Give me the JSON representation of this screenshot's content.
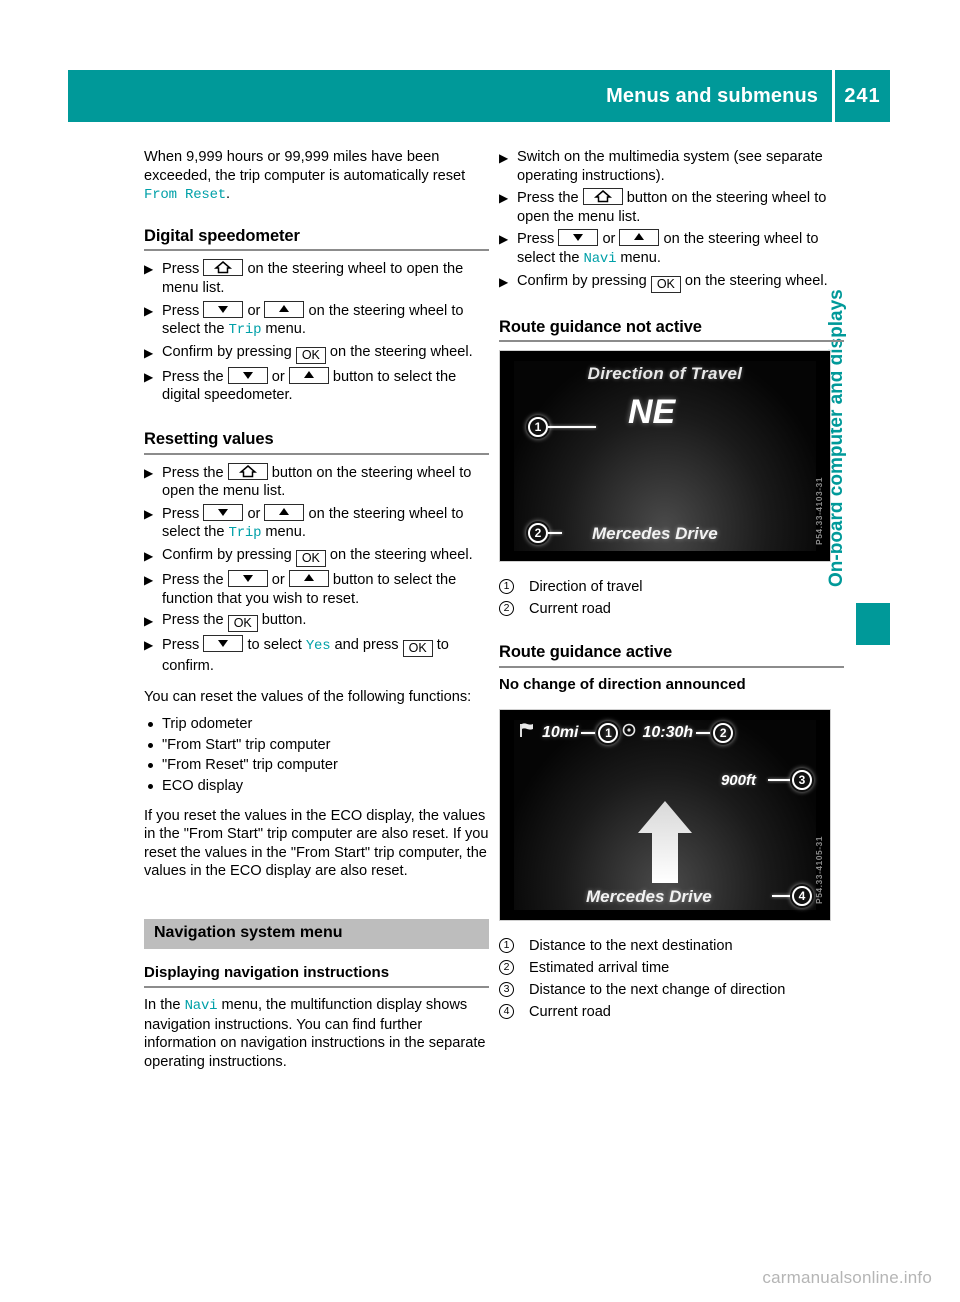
{
  "header": {
    "title": "Menus and submenus",
    "page_number": "241"
  },
  "side_tab": {
    "label": "On-board computer and displays",
    "color": "#009999"
  },
  "watermark": "carmanualsonline.info",
  "left_column": {
    "intro_paragraph": {
      "before": "When 9,999 hours or 99,999 miles have been exceeded, the trip computer is automatically reset ",
      "term": "From Reset",
      "after": "."
    },
    "digital_speedometer": {
      "heading": "Digital speedometer",
      "steps": [
        {
          "a": "Press",
          "key": "home",
          "b": "on the steering wheel to open the menu list."
        },
        {
          "a": "Press",
          "key": "down",
          "mid": "or",
          "key2": "up",
          "b": "on the steering wheel to select the ",
          "term": "Trip",
          "c": " menu."
        },
        {
          "a": "Confirm by pressing",
          "key": "ok",
          "b": "on the steering wheel."
        },
        {
          "a": "Press the",
          "key": "down",
          "mid": "or",
          "key2": "up",
          "b": "button to select the digital speedometer."
        }
      ]
    },
    "resetting_values": {
      "heading": "Resetting values",
      "steps": [
        {
          "a": "Press the",
          "key": "home",
          "b": "button on the steering wheel to open the menu list."
        },
        {
          "a": "Press",
          "key": "down",
          "mid": "or",
          "key2": "up",
          "b": "on the steering wheel to select the ",
          "term": "Trip",
          "c": " menu."
        },
        {
          "a": "Confirm by pressing",
          "key": "ok",
          "b": "on the steering wheel."
        },
        {
          "a": "Press the",
          "key": "down",
          "mid": "or",
          "key2": "up",
          "b": "button to select the function that you wish to reset."
        },
        {
          "a": "Press the",
          "key": "ok",
          "b": "button."
        },
        {
          "a": "Press",
          "key": "down",
          "b": "to select ",
          "term": "Yes",
          "c": " and press ",
          "key2": "ok",
          "d": " to confirm."
        }
      ],
      "list_intro": "You can reset the values of the following functions:",
      "items": [
        "Trip odometer",
        "\"From Start\" trip computer",
        "\"From Reset\" trip computer",
        "ECO display"
      ],
      "closing_paragraph": "If you reset the values in the ECO display, the values in the \"From Start\" trip computer are also reset. If you reset the values in the \"From Start\" trip computer, the values in the ECO display are also reset."
    },
    "navigation_system_menu": {
      "bar_title": "Navigation system menu",
      "subheading": "Displaying navigation instructions",
      "paragraph": {
        "before": "In the ",
        "term": "Navi",
        "after": " menu, the multifunction display shows navigation instructions. You can find further information on navigation instructions in the separate operating instructions."
      }
    }
  },
  "right_column": {
    "steps": [
      {
        "a": "Switch on the multimedia system (see separate operating instructions)."
      },
      {
        "a": "Press the",
        "key": "home",
        "b": "button on the steering wheel to open the menu list."
      },
      {
        "a": "Press",
        "key": "down",
        "mid": "or",
        "key2": "up",
        "b": "on the steering wheel to select the ",
        "term": "Navi",
        "c": " menu."
      },
      {
        "a": "Confirm by pressing",
        "key": "ok",
        "b": "on the steering wheel."
      }
    ],
    "route_not_active": {
      "heading": "Route guidance not active",
      "display": {
        "title": "Direction of Travel",
        "direction": "NE",
        "road": "Mercedes Drive",
        "marker_1": "1",
        "marker_2": "2",
        "code": "P54.33-4103-31"
      },
      "legend": [
        {
          "num": "1",
          "text": "Direction of travel"
        },
        {
          "num": "2",
          "text": "Current road"
        }
      ]
    },
    "route_active": {
      "heading": "Route guidance active",
      "subheading": "No change of direction announced",
      "display": {
        "distance_destination": "10mi",
        "arrival_time": "10:30h",
        "distance_next_turn": "900ft",
        "road": "Mercedes Drive",
        "marker_1": "1",
        "marker_2": "2",
        "marker_3": "3",
        "marker_4": "4",
        "code": "P54.33-4105-31"
      },
      "legend": [
        {
          "num": "1",
          "text": "Distance to the next destination"
        },
        {
          "num": "2",
          "text": "Estimated arrival time"
        },
        {
          "num": "3",
          "text": "Distance to the next change of direction"
        },
        {
          "num": "4",
          "text": "Current road"
        }
      ]
    }
  }
}
